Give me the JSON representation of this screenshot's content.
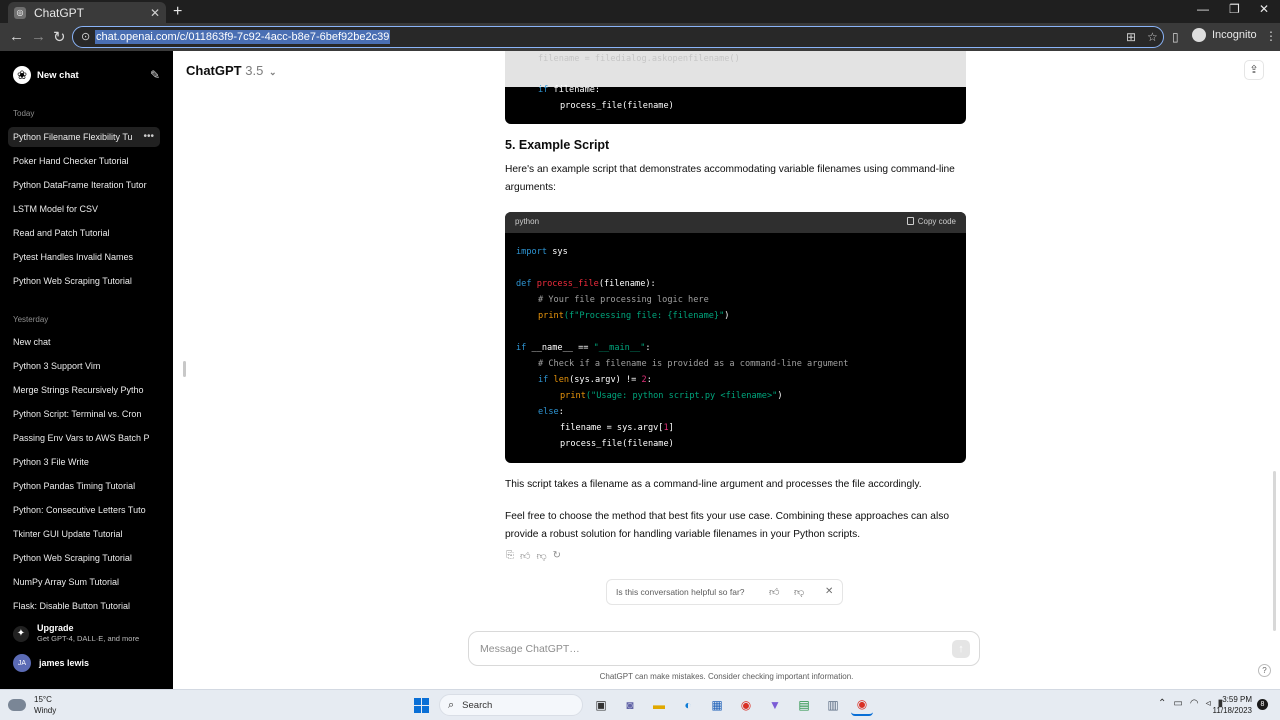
{
  "browser": {
    "tab_title": "ChatGPT",
    "url": "chat.openai.com/c/011863f9-7c92-4acc-b8e7-6bef92be2c39",
    "profile_label": "Incognito"
  },
  "sidebar": {
    "new_chat": "New chat",
    "groups": {
      "today": "Today",
      "yesterday": "Yesterday"
    },
    "today_items": [
      "Python Filename Flexibility Tu",
      "Poker Hand Checker Tutorial",
      "Python DataFrame Iteration Tutor",
      "LSTM Model for CSV",
      "Read and Patch Tutorial",
      "Pytest Handles Invalid Names",
      "Python Web Scraping Tutorial"
    ],
    "yesterday_items": [
      "New chat",
      "Python 3 Support Vim",
      "Merge Strings Recursively Pytho",
      "Python Script: Terminal vs. Cron",
      "Passing Env Vars to AWS Batch P",
      "Python 3 File Write",
      "Python Pandas Timing Tutorial",
      "Python: Consecutive Letters Tuto",
      "Tkinter GUI Update Tutorial",
      "Python Web Scraping Tutorial",
      "NumPy Array Sum Tutorial",
      "Flask: Disable Button Tutorial"
    ],
    "upgrade_title": "Upgrade",
    "upgrade_sub": "Get GPT-4, DALL·E, and more",
    "user_initials": "JA",
    "user_name": "james lewis"
  },
  "main": {
    "model_name": "ChatGPT",
    "model_version": "3.5",
    "prev_code_faded": "filename = filedialog.askopenfilename()",
    "prev_code_line1_kw": "if",
    "prev_code_line1_rest": " filename:",
    "prev_code_line2": "process_file(filename)",
    "heading": "5. Example Script",
    "intro": "Here's an example script that demonstrates accommodating variable filenames using command-line arguments:",
    "code_lang": "python",
    "copy_label": "Copy code",
    "outro1": "This script takes a filename as a command-line argument and processes the file accordingly.",
    "outro2": "Feel free to choose the method that best fits your use case. Combining these approaches can also provide a robust solution for handling variable filenames in your Python scripts.",
    "feedback_question": "Is this conversation helpful so far?",
    "composer_placeholder": "Message ChatGPT…",
    "disclaimer": "ChatGPT can make mistakes. Consider checking important information.",
    "help_label": "?"
  },
  "code": {
    "l1_kw": "import",
    "l1_rest": " sys",
    "l2_kw": "def",
    "l2_fn": "process_file",
    "l2_rest": "(filename):",
    "l3_cm": "# Your file processing logic here",
    "l4_bi": "print",
    "l4_str": "(f\"Processing file: {filename}\"",
    "l4_end": ")",
    "l5_kw": "if",
    "l5_mid": " __name__ == ",
    "l5_str": "\"__main__\"",
    "l5_end": ":",
    "l6_cm": "# Check if a filename is provided as a command-line argument",
    "l7_kw": "if",
    "l7_bi": "len",
    "l7_mid": "(sys.argv) != ",
    "l7_num": "2",
    "l7_end": ":",
    "l8_bi": "print",
    "l8_str": "(\"Usage: python script.py <filename>\"",
    "l8_end": ")",
    "l9_kw": "else",
    "l9_end": ":",
    "l10_a": "filename = sys.argv[",
    "l10_num": "1",
    "l10_b": "]",
    "l11": "process_file(filename)"
  },
  "taskbar": {
    "temp": "15°C",
    "weather": "Windy",
    "search": "Search",
    "time": "3:59 PM",
    "date": "11/18/2023",
    "notif_count": "8"
  },
  "colors": {
    "sidebar_bg": "#000000",
    "code_bg": "#000000",
    "keyword": "#2e95d3",
    "function": "#f22c3d",
    "string": "#00a67d"
  }
}
